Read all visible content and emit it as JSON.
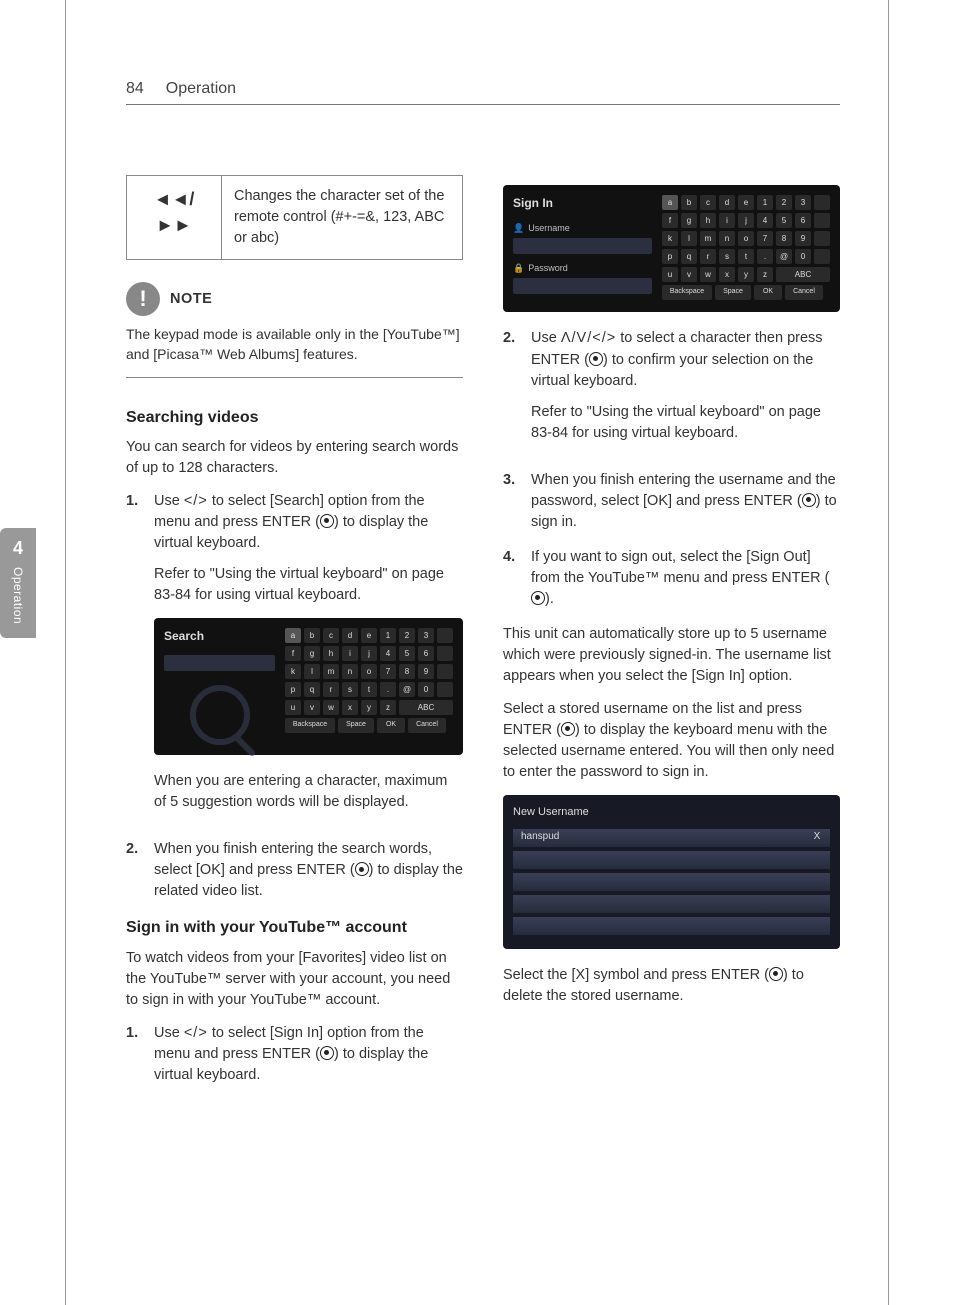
{
  "header": {
    "page_number": "84",
    "chapter": "Operation"
  },
  "side_tab": {
    "number": "4",
    "label": "Operation"
  },
  "table": {
    "icon_left": "◄◄",
    "icon_sep": "/",
    "icon_right": "►►",
    "desc": "Changes the character set of the remote control (#+-=&, 123, ABC or abc)"
  },
  "note": {
    "label": "NOTE",
    "body": "The keypad mode is available only in the [YouTube™] and [Picasa™ Web Albums] features."
  },
  "left": {
    "h_search": "Searching videos",
    "p_search_intro": "You can search for videos by entering search words of up to 128 characters.",
    "step1_num": "1.",
    "step1_a": "Use ",
    "step1_arrows": "</>",
    "step1_b": " to select [Search] option from the menu and press ENTER (",
    "step1_c": ") to display the virtual keyboard.",
    "step1_ref": "Refer to \"Using the virtual keyboard\" on page 83-84 for using virtual keyboard.",
    "search_ss_title": "Search",
    "after_search_img": "When you are entering a character, maximum of 5 suggestion words will be displayed.",
    "step2_num": "2.",
    "step2_a": "When you finish entering the search words, select [OK] and press ENTER (",
    "step2_b": ") to display the related video list.",
    "h_signin": "Sign in with your YouTube™ account",
    "p_signin_intro": "To watch videos from your [Favorites] video list on the YouTube™ server with your account, you need to sign in with your YouTube™ account.",
    "si_step1_num": "1.",
    "si_step1_a": "Use ",
    "si_step1_arrows": "</>",
    "si_step1_b": " to select [Sign In] option from the menu and press ENTER (",
    "si_step1_c": ") to display the virtual keyboard."
  },
  "right": {
    "sign_ss_title": "Sign In",
    "sign_ss_user": "Username",
    "sign_ss_pass": "Password",
    "step2_num": "2.",
    "step2_a": "Use ",
    "step2_arrows": "Λ/V/</>",
    "step2_b": " to select a character then press ENTER (",
    "step2_c": ") to confirm your selection on the virtual keyboard.",
    "step2_ref": "Refer to \"Using the virtual keyboard\" on page 83-84 for using virtual keyboard.",
    "step3_num": "3.",
    "step3_a": "When you finish entering the username and the password, select [OK] and press ENTER (",
    "step3_b": ") to sign in.",
    "step4_num": "4.",
    "step4_a": "If you want to sign out, select the [Sign Out] from the YouTube™ menu and press ENTER (",
    "step4_b": ").",
    "p_store": "This unit can automatically store up to 5 username which were previously signed-in. The username list appears when you select the [Sign In] option.",
    "p_select_a": "Select a stored username on the list and press ENTER (",
    "p_select_b": ") to display the keyboard menu with the selected username entered. You will then only need to enter the password to sign in.",
    "userlist_header": "New Username",
    "userlist_item": "hanspud",
    "userlist_x": "X",
    "p_delete_a": "Select the [X] symbol and press ENTER (",
    "p_delete_b": ") to delete the stored username."
  },
  "keyboard": {
    "row1": [
      "a",
      "b",
      "c",
      "d",
      "e",
      "1",
      "2",
      "3"
    ],
    "row2": [
      "f",
      "g",
      "h",
      "i",
      "j",
      "4",
      "5",
      "6"
    ],
    "row3": [
      "k",
      "l",
      "m",
      "n",
      "o",
      "7",
      "8",
      "9"
    ],
    "row4": [
      "p",
      "q",
      "r",
      "s",
      "t",
      ".",
      "@",
      "0"
    ],
    "row5": [
      "u",
      "v",
      "w",
      "x",
      "y",
      "z",
      "ABC"
    ],
    "bottom": [
      "Backspace",
      "Space",
      "OK",
      "Cancel"
    ]
  }
}
